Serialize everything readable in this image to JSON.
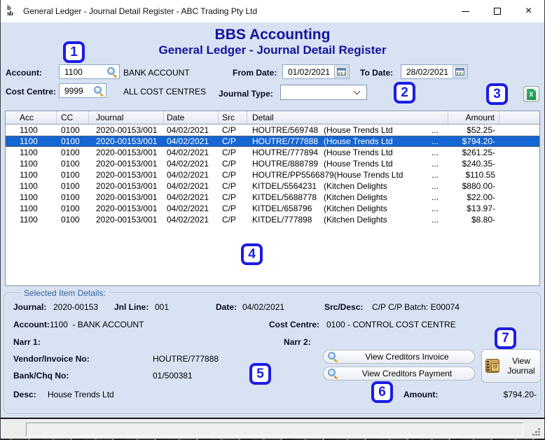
{
  "window": {
    "title": "General Ledger - Journal Detail Register - ABC Trading Pty Ltd",
    "icon_monogram": "bb sb",
    "close_glyph": "×"
  },
  "header": {
    "app_title": "BBS Accounting",
    "screen_title": "General Ledger - Journal Detail Register"
  },
  "filters": {
    "account": {
      "label": "Account:",
      "value": "1100",
      "desc": "BANK ACCOUNT"
    },
    "cost_centre": {
      "label": "Cost Centre:",
      "value": "9999",
      "desc": "ALL COST CENTRES"
    },
    "from_date": {
      "label": "From Date:",
      "value": "01/02/2021"
    },
    "to_date": {
      "label": "To Date:",
      "value": "28/02/2021"
    },
    "journal_type": {
      "label": "Journal Type:",
      "value": ""
    }
  },
  "annotations": {
    "n1": "1",
    "n2": "2",
    "n3": "3",
    "n4": "4",
    "n5": "5",
    "n6": "6",
    "n7": "7"
  },
  "table": {
    "columns": [
      "Acc",
      "CC",
      "Journal",
      "Date",
      "Src",
      "Detail",
      "Amount"
    ],
    "rows": [
      {
        "acc": "1100",
        "cc": "0100",
        "journal": "2020-00153/001",
        "date": "04/02/2021",
        "src": "C/P",
        "invoice": "HOUTRE/569748",
        "vendor": "(House Trends Ltd",
        "ellipsis": "...",
        "amount": "$52.25-",
        "selected": false
      },
      {
        "acc": "1100",
        "cc": "0100",
        "journal": "2020-00153/001",
        "date": "04/02/2021",
        "src": "C/P",
        "invoice": "HOUTRE/777888",
        "vendor": "(House Trends Ltd",
        "ellipsis": "...",
        "amount": "$794.20-",
        "selected": true
      },
      {
        "acc": "1100",
        "cc": "0100",
        "journal": "2020-00153/001",
        "date": "04/02/2021",
        "src": "C/P",
        "invoice": "HOUTRE/777894",
        "vendor": "(House Trends Ltd",
        "ellipsis": "...",
        "amount": "$261.25-",
        "selected": false
      },
      {
        "acc": "1100",
        "cc": "0100",
        "journal": "2020-00153/001",
        "date": "04/02/2021",
        "src": "C/P",
        "invoice": "HOUTRE/888789",
        "vendor": "(House Trends Ltd",
        "ellipsis": "...",
        "amount": "$240.35-",
        "selected": false
      },
      {
        "acc": "1100",
        "cc": "0100",
        "journal": "2020-00153/001",
        "date": "04/02/2021",
        "src": "C/P",
        "invoice": "HOUTRE/PP5566879",
        "vendor": "(House Trends Ltd",
        "ellipsis": "...",
        "amount": "$110.55",
        "selected": false
      },
      {
        "acc": "1100",
        "cc": "0100",
        "journal": "2020-00153/001",
        "date": "04/02/2021",
        "src": "C/P",
        "invoice": "KITDEL/5564231",
        "vendor": "(Kitchen Delights",
        "ellipsis": "...",
        "amount": "$880.00-",
        "selected": false
      },
      {
        "acc": "1100",
        "cc": "0100",
        "journal": "2020-00153/001",
        "date": "04/02/2021",
        "src": "C/P",
        "invoice": "KITDEL/5688778",
        "vendor": "(Kitchen Delights",
        "ellipsis": "...",
        "amount": "$22.00-",
        "selected": false
      },
      {
        "acc": "1100",
        "cc": "0100",
        "journal": "2020-00153/001",
        "date": "04/02/2021",
        "src": "C/P",
        "invoice": "KITDEL/658796",
        "vendor": "(Kitchen Delights",
        "ellipsis": "...",
        "amount": "$13.97-",
        "selected": false
      },
      {
        "acc": "1100",
        "cc": "0100",
        "journal": "2020-00153/001",
        "date": "04/02/2021",
        "src": "C/P",
        "invoice": "KITDEL/777898",
        "vendor": "(Kitchen Delights",
        "ellipsis": "...",
        "amount": "$8.80-",
        "selected": false
      }
    ]
  },
  "details": {
    "legend": "Selected Item Details:",
    "journal": {
      "label": "Journal:",
      "value": "2020-00153"
    },
    "jnl_line": {
      "label": "Jnl Line:",
      "value": "001"
    },
    "date": {
      "label": "Date:",
      "value": "04/02/2021"
    },
    "src_desc": {
      "label": "Src/Desc:",
      "value": "C/P C/P Batch: E00074"
    },
    "account": {
      "label": "Account:",
      "value": "1100  - BANK ACCOUNT"
    },
    "cost_centre": {
      "label": "Cost Centre:",
      "value": "0100 - CONTROL COST CENTRE"
    },
    "narr1": {
      "label": "Narr 1:",
      "value": ""
    },
    "narr2": {
      "label": "Narr 2:",
      "value": ""
    },
    "vendor_invoice": {
      "label": "Vendor/Invoice No:",
      "value": "HOUTRE/777888"
    },
    "bank_chq": {
      "label": "Bank/Chq No:",
      "value": "01/500381"
    },
    "desc": {
      "label": "Desc:",
      "value": "House Trends Ltd"
    },
    "amount": {
      "label": "Amount:",
      "value": "$794.20-"
    },
    "buttons": {
      "view_creditors_invoice": "View Creditors Invoice",
      "view_creditors_payment": "View Creditors Payment",
      "view_journal": "View Journal"
    }
  },
  "status_bar": {
    "message": ""
  },
  "colors": {
    "annotation_blue": "#1c1ce8",
    "title_navy": "#13139e",
    "selection_blue": "#1565d2",
    "legend_blue": "#3465a4",
    "page_background": "#d8e2f2",
    "excel_green": "#21a366"
  },
  "icons": {
    "app_icon": "bbs-monogram",
    "minimize_icon": "horizontal-bar",
    "maximize_icon": "square-outline",
    "close_icon": "×",
    "lookup_icon": "magnifier",
    "calendar_icon": "calendar-grid",
    "dropdown_icon": "chevron-down",
    "excel_icon": "green-spreadsheet",
    "journal_book_icon": "ledger-book",
    "resize_grip_icon": "diagonal-dots"
  }
}
